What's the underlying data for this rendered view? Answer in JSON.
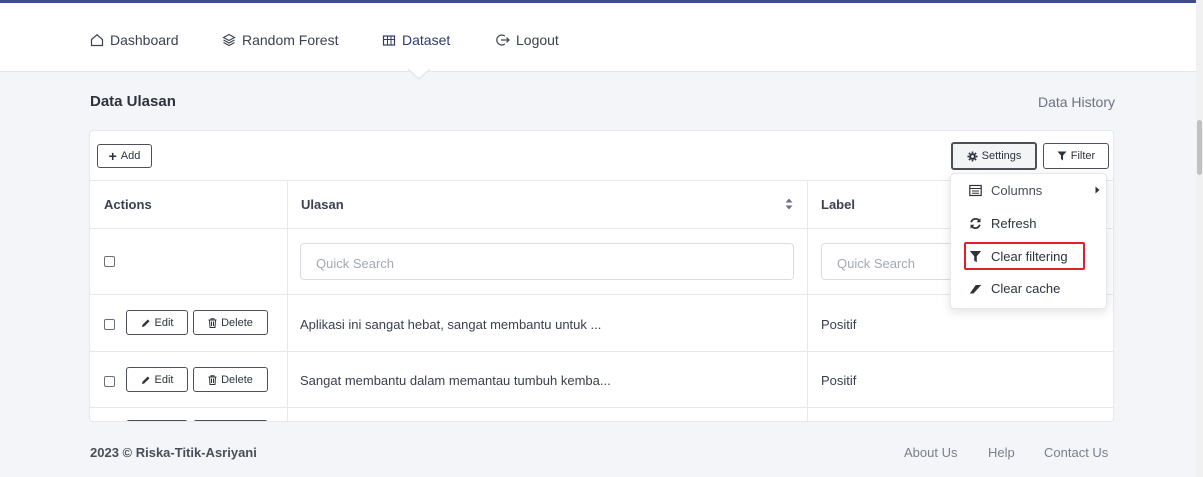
{
  "nav": {
    "items": [
      {
        "label": "Dashboard",
        "icon": "home-icon"
      },
      {
        "label": "Random Forest",
        "icon": "layers-icon"
      },
      {
        "label": "Dataset",
        "icon": "dataset-icon"
      },
      {
        "label": "Logout",
        "icon": "logout-icon"
      }
    ],
    "active": "Dataset"
  },
  "page": {
    "title": "Data Ulasan",
    "link": "Data History"
  },
  "toolbar": {
    "add_label": "Add",
    "settings_label": "Settings",
    "filter_label": "Filter"
  },
  "table": {
    "headers": [
      "Actions",
      "Ulasan",
      "Label"
    ],
    "search_placeholder": "Quick Search",
    "edit_label": "Edit",
    "delete_label": "Delete",
    "rows": [
      {
        "ulasan": "Aplikasi ini sangat hebat, sangat membantu untuk ...",
        "label": "Positif"
      },
      {
        "ulasan": "Sangat membantu dalam memantau tumbuh kemba...",
        "label": "Positif"
      }
    ]
  },
  "dropdown": {
    "items": [
      {
        "label": "Columns",
        "icon": "columns-icon"
      },
      {
        "label": "Refresh",
        "icon": "refresh-icon"
      },
      {
        "label": "Clear filtering",
        "icon": "filter-icon"
      },
      {
        "label": "Clear cache",
        "icon": "eraser-icon"
      }
    ]
  },
  "footer": {
    "copyright": "2023 © Riska-Titik-Asriyani",
    "links": [
      "About Us",
      "Help",
      "Contact Us"
    ]
  },
  "colors": {
    "accent": "#3f4b8c",
    "highlight": "#e0202a"
  }
}
